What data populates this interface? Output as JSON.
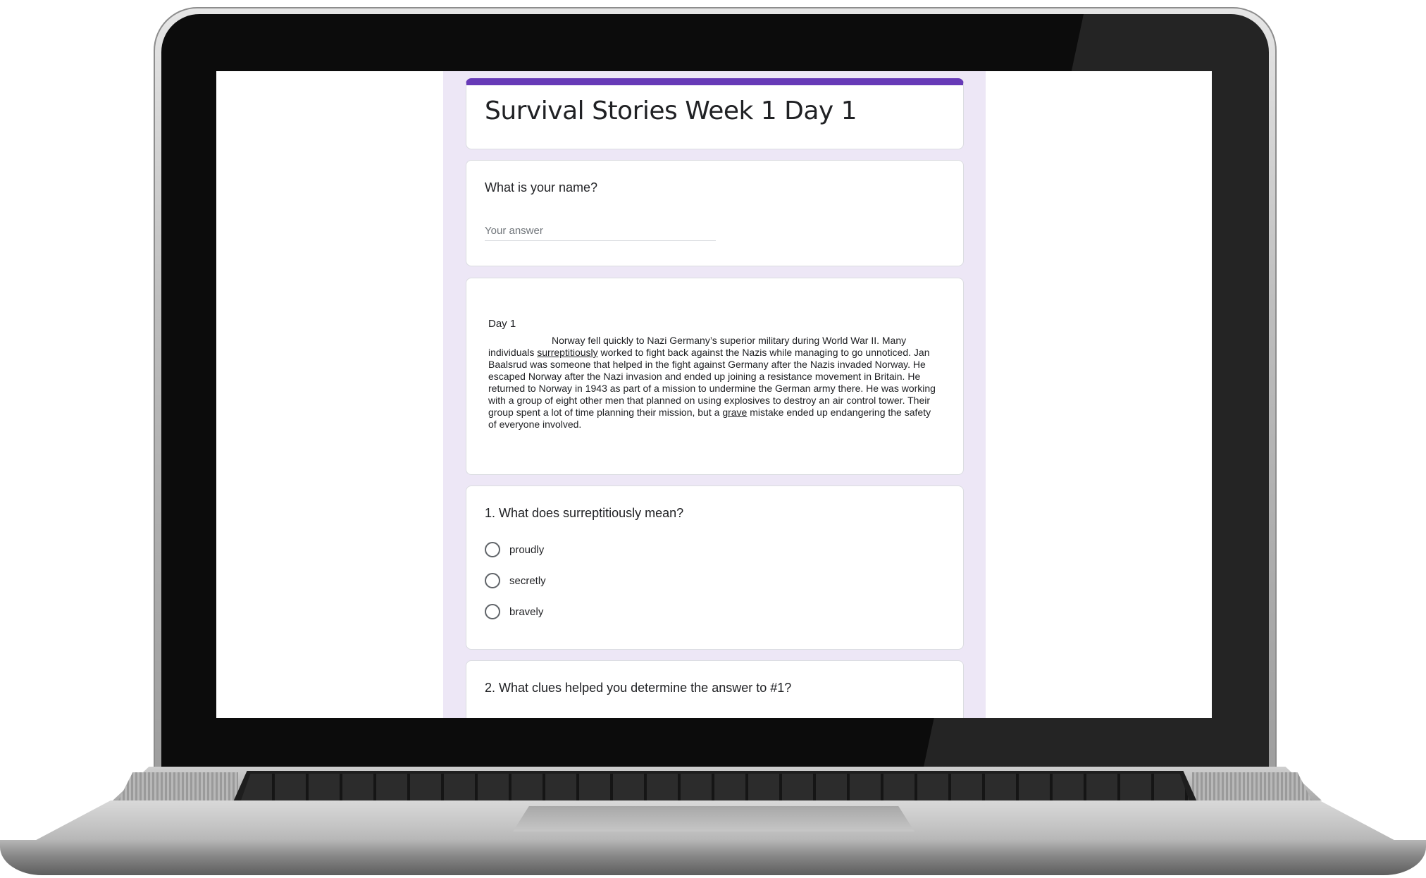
{
  "form": {
    "title": "Survival Stories Week 1 Day 1",
    "accent_color": "#673ab7",
    "background_color": "#ede7f6"
  },
  "name_question": {
    "label": "What is your name?",
    "placeholder": "Your answer"
  },
  "passage": {
    "heading": "Day 1",
    "text_before_word1": "Norway fell quickly to Nazi Germany’s superior military during World War II. Many individuals ",
    "word1": "surreptitiously",
    "text_after_word1": " worked to fight back against the Nazis while managing to go unnoticed. Jan Baalsrud was someone that helped in the fight against Germany after the Nazis invaded Norway. He escaped Norway after the Nazi invasion and ended up joining a resistance movement in Britain. He returned to Norway in 1943 as part of a mission to undermine the German army there. He was working with a group of eight other men that planned on using explosives to destroy an air control tower. Their group spent a lot of time planning their mission, but a ",
    "word2": "grave",
    "text_after_word2": " mistake ended up endangering the safety of everyone involved."
  },
  "question1": {
    "label": "1. What does surreptitiously mean?",
    "options": [
      "proudly",
      "secretly",
      "bravely"
    ]
  },
  "question2": {
    "label": "2. What clues helped you determine the answer to #1?"
  }
}
